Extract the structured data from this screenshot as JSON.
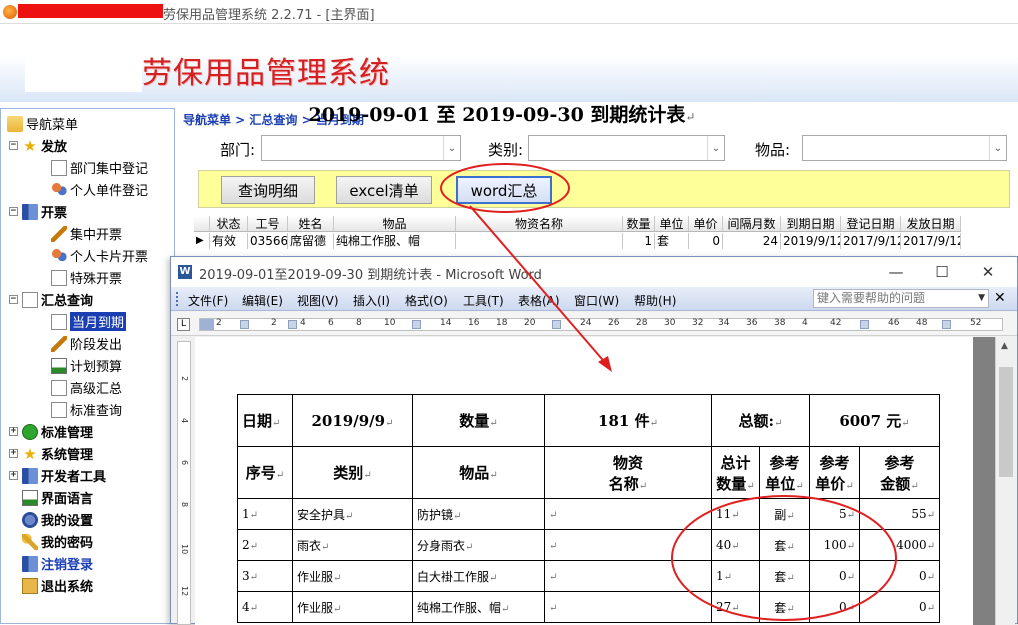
{
  "window": {
    "title_suffix": "劳保用品管理系统 2.2.71 - [主界面]"
  },
  "banner": {
    "app_title": "劳保用品管理系统"
  },
  "nav": {
    "root": "导航菜单",
    "items": [
      {
        "label": "发放",
        "level": 1,
        "icon": "star-icon"
      },
      {
        "label": "部门集中登记",
        "level": 2,
        "icon": "document-icon"
      },
      {
        "label": "个人单件登记",
        "level": 2,
        "icon": "people-icon"
      },
      {
        "label": "开票",
        "level": 1,
        "icon": "book-icon"
      },
      {
        "label": "集中开票",
        "level": 2,
        "icon": "edit-icon"
      },
      {
        "label": "个人卡片开票",
        "level": 2,
        "icon": "user-edit-icon"
      },
      {
        "label": "特殊开票",
        "level": 2,
        "icon": "document-icon"
      },
      {
        "label": "汇总查询",
        "level": 1,
        "icon": "document-icon"
      },
      {
        "label": "当月到期",
        "level": 2,
        "icon": "calendar-icon"
      },
      {
        "label": "阶段发出",
        "level": 2,
        "icon": "pencil-icon"
      },
      {
        "label": "计划预算",
        "level": 2,
        "icon": "chart-icon"
      },
      {
        "label": "高级汇总",
        "level": 2,
        "icon": "document-icon"
      },
      {
        "label": "标准查询",
        "level": 2,
        "icon": "document-icon"
      },
      {
        "label": "标准管理",
        "level": 1,
        "icon": "green-arrow-icon"
      },
      {
        "label": "系统管理",
        "level": 1,
        "icon": "star-icon"
      },
      {
        "label": "开发者工具",
        "level": 1,
        "icon": "book-icon"
      },
      {
        "label": "界面语言",
        "level": 1,
        "icon": "chart-icon"
      },
      {
        "label": "我的设置",
        "level": 1,
        "icon": "gear-icon"
      },
      {
        "label": "我的密码",
        "level": 1,
        "icon": "key-icon"
      },
      {
        "label": "注销登录",
        "level": 1,
        "icon": "book-icon"
      },
      {
        "label": "退出系统",
        "level": 1,
        "icon": "exit-icon"
      }
    ]
  },
  "breadcrumb": "导航菜单 > 汇总查询 > 当月到期",
  "filters": {
    "dept_label": "部门:",
    "category_label": "类别:",
    "item_label": "物品:",
    "dept_value": "",
    "category_value": "",
    "item_value": ""
  },
  "buttons": {
    "detail": "查询明细",
    "excel": "excel清单",
    "word": "word汇总"
  },
  "grid": {
    "columns": [
      "状态",
      "工号",
      "姓名",
      "物品",
      "物资名称",
      "数量",
      "单位",
      "单价",
      "间隔月数",
      "到期日期",
      "登记日期",
      "发放日期"
    ],
    "rows": [
      [
        "有效",
        "03566",
        "席留德",
        "纯棉工作服、帽",
        "",
        "1",
        "套",
        "0",
        "24",
        "2019/9/12",
        "2017/9/12",
        "2017/9/12"
      ]
    ]
  },
  "word": {
    "title": "2019-09-01至2019-09-30 到期统计表 - Microsoft Word",
    "menus": [
      "文件(F)",
      "编辑(E)",
      "视图(V)",
      "插入(I)",
      "格式(O)",
      "工具(T)",
      "表格(A)",
      "窗口(W)",
      "帮助(H)"
    ],
    "help_placeholder": "键入需要帮助的问题",
    "ruler_ticks": [
      "2",
      "2",
      "4",
      "6",
      "8",
      "10",
      "14",
      "16",
      "18",
      "20",
      "24",
      "26",
      "28",
      "30",
      "32",
      "34",
      "36",
      "38",
      "4",
      "42",
      "46",
      "48",
      "52"
    ],
    "vruler_ticks": [
      "2",
      "4",
      "6",
      "8",
      "10",
      "12"
    ],
    "doc": {
      "title": "2019-09-01 至 2019-09-30  到期统计表",
      "summary": {
        "date_label": "日期",
        "date_value": "2019/9/9",
        "qty_label": "数量",
        "qty_value": "181 件",
        "total_label": "总额:",
        "total_value": "6007 元"
      },
      "headers": [
        "序号",
        "类别",
        "物品",
        "物资名称",
        "总计数量",
        "参考单位",
        "参考单价",
        "参考金额"
      ],
      "rows": [
        [
          "1",
          "安全护具",
          "防护镜",
          "",
          "11",
          "副",
          "5",
          "55"
        ],
        [
          "2",
          "雨衣",
          "分身雨衣",
          "",
          "40",
          "套",
          "100",
          "4000"
        ],
        [
          "3",
          "作业服",
          "白大褂工作服",
          "",
          "1",
          "套",
          "0",
          "0"
        ],
        [
          "4",
          "作业服",
          "纯棉工作服、帽",
          "",
          "27",
          "套",
          "0",
          "0"
        ]
      ]
    }
  },
  "colors": {
    "title_red": "#d42020",
    "nav_blue": "#1b3fb3",
    "button_bar": "#ffff99",
    "annotation_red": "#e02020"
  }
}
